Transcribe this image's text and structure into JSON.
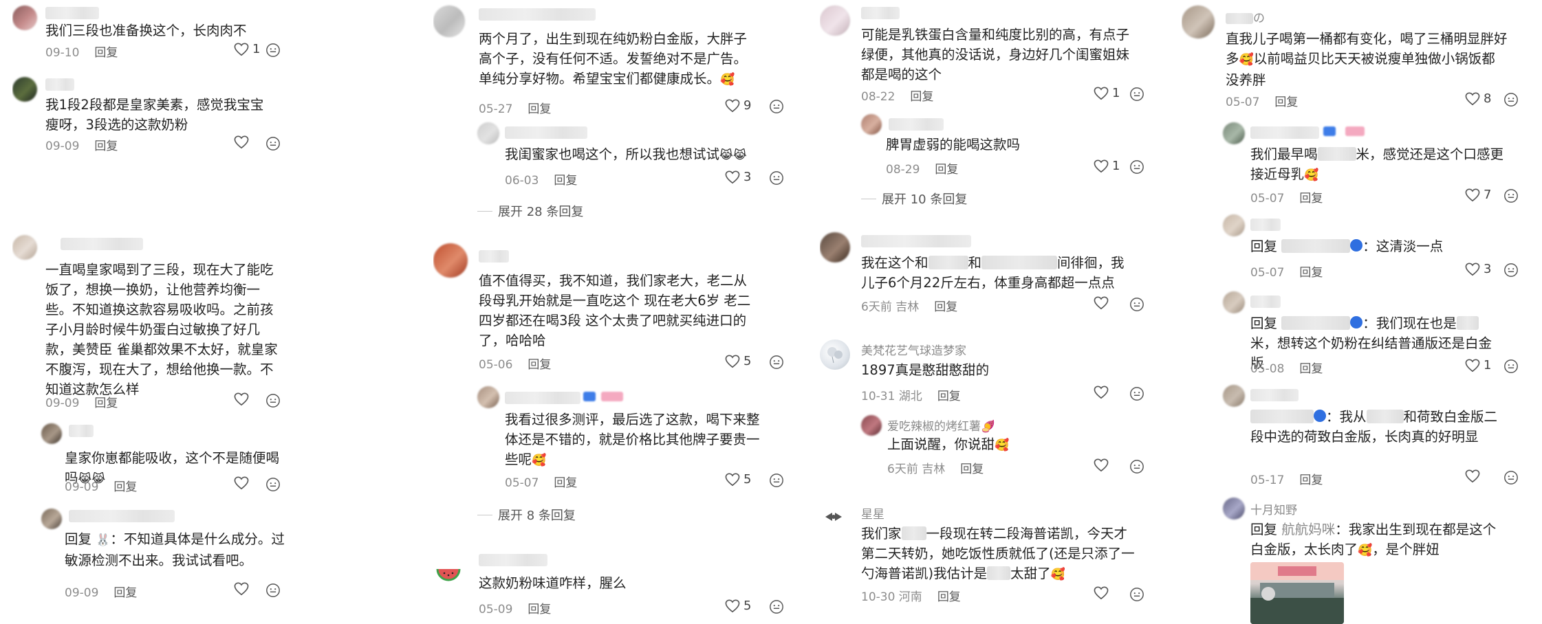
{
  "reply_label": "回复",
  "columns": [
    {
      "comments": [
        {
          "text": "我们三段也准备换这个，长肉肉不",
          "date": "09-10",
          "likes": "1"
        },
        {
          "text": "我1段2段都是皇家美素，感觉我宝宝瘦呀，3段选的这款奶粉",
          "date": "09-09",
          "likes": ""
        },
        {
          "text": "一直喝皇家喝到了三段，现在大了能吃饭了，想换一换奶，让他营养均衡一些。不知道换这款容易吸收吗。之前孩子小月龄时候牛奶蛋白过敏换了好几款，美赞臣 雀巢都效果不太好，就皇家不腹泻，现在大了，想给他换一款。不知道这款怎么样",
          "date": "09-09",
          "likes": ""
        },
        {
          "text": "皇家你崽都能吸收，这个不是随便喝吗",
          "date": "09-09",
          "likes": ""
        },
        {
          "text_prefix": "回复",
          "text": "：不知道具体是什么成分。过敏源检测不出来。我试试看吧。",
          "date": "09-09",
          "likes": ""
        }
      ]
    },
    {
      "comments": [
        {
          "text": "两个月了，出生到现在纯奶粉白金版，大胖子高个子，没有任何不适。发誓绝对不是广告。单纯分享好物。希望宝宝们都健康成长。",
          "date": "05-27",
          "likes": "9"
        },
        {
          "text": "我闺蜜家也喝这个，所以我也想试试",
          "date": "06-03",
          "likes": "3"
        },
        {
          "expand": "展开 28 条回复"
        },
        {
          "text": "值不值得买，我不知道，我们家老大，老二从段母乳开始就是一直吃这个 现在老大6岁 老二四岁都还在喝3段 这个太贵了吧就买纯进口的了，哈哈哈",
          "date": "05-06",
          "likes": "5"
        },
        {
          "text": "我看过很多测评，最后选了这款，喝下来整体还是不错的，就是价格比其他牌子要贵一些呢",
          "date": "05-07",
          "likes": "5"
        },
        {
          "expand": "展开 8 条回复"
        },
        {
          "text": "这款奶粉味道咋样，腥么",
          "date": "05-09",
          "likes": "5"
        }
      ]
    },
    {
      "comments": [
        {
          "text": "可能是乳铁蛋白含量和纯度比别的高，有点子绿便，其他真的没话说，身边好几个闺蜜姐妹都是喝的这个",
          "date": "08-22",
          "likes": "1"
        },
        {
          "text": "脾胃虚弱的能喝这款吗",
          "date": "08-29",
          "likes": "1"
        },
        {
          "expand": "展开 10 条回复"
        },
        {
          "text_a": "我在这个和",
          "text_b": "和",
          "text_c": "间徘徊，我儿子6个月22斤左右，体重身高都超一点点",
          "date": "6天前 吉林",
          "likes": ""
        },
        {
          "user": "美梵花艺气球造梦家",
          "text": "1897真是憨甜憨甜的",
          "date": "10-31 湖北",
          "likes": ""
        },
        {
          "user": "爱吃辣椒的烤红薯",
          "text": "上面说醒，你说甜",
          "date": "6天前 吉林",
          "likes": ""
        },
        {
          "user": "星星",
          "text_a": "我们家",
          "text_b": "一段现在转二段海普诺凯，今天才第二天转奶，她吃饭性质就低了(还是只添了一勺海普诺凯)我估计是",
          "text_c": "太甜了",
          "date": "10-30 河南",
          "likes": ""
        }
      ]
    },
    {
      "comments": [
        {
          "user_suffix": "の",
          "text": "直我儿子喝第一桶都有变化，喝了三桶明显胖好多",
          "text_b": "以前喝益贝比天天被说瘦单独做小锅饭都没养胖",
          "date": "05-07",
          "likes": "8"
        },
        {
          "text_a": "我们最早喝",
          "text_b": "米，感觉还是这个口感更接近母乳",
          "date": "05-07",
          "likes": "7"
        },
        {
          "text_prefix": "回复",
          "text": "：这清淡一点",
          "date": "05-07",
          "likes": "3"
        },
        {
          "text_prefix": "回复",
          "text": "：我们现在也是",
          "text_b": "米，想转这个奶粉在纠结普通版还是白金版",
          "date": "05-08",
          "likes": "1"
        },
        {
          "text_a": "：我从",
          "text_b": "和荷致白金版二段中选的荷致白金版，长肉真的好明显",
          "date": "05-17",
          "likes": ""
        },
        {
          "user": "十月知野",
          "text_prefix": "回复",
          "reply_to": "航航妈咪",
          "text": "：我家出生到现在都是这个白金版，太长肉了",
          "text_b": "，是个胖妞"
        }
      ]
    }
  ]
}
